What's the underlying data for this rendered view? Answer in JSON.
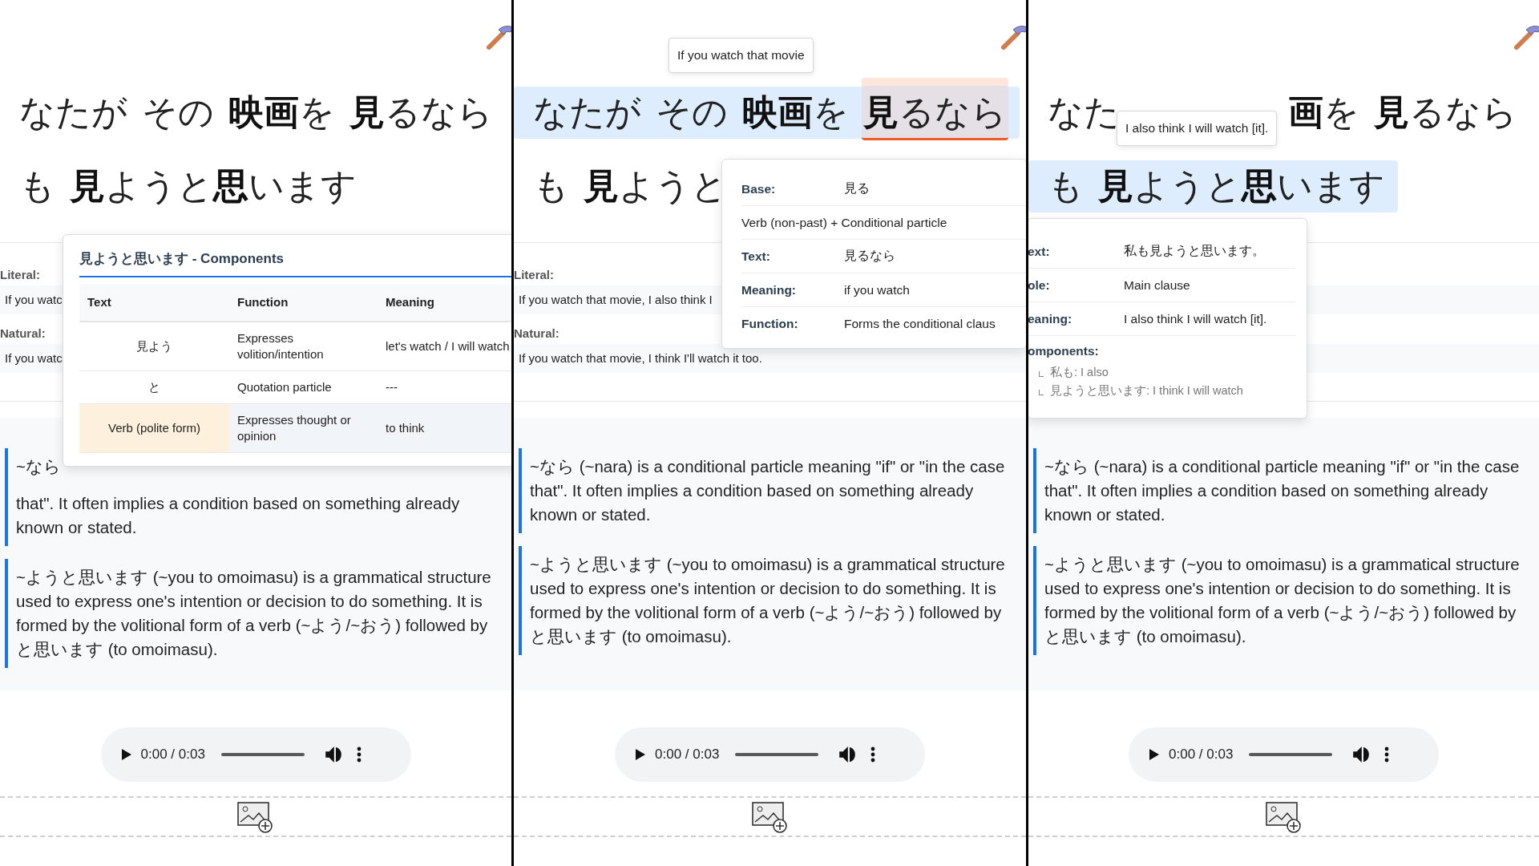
{
  "panels": [
    {
      "sentence": [
        {
          "highlighted": false,
          "covered": false,
          "words": [
            {
              "text": "なたが",
              "selected": false
            },
            {
              "text": "その",
              "selected": false
            },
            {
              "text": "**映画**を",
              "selected": false
            },
            {
              "text": "**見**るなら",
              "selected": false
            }
          ]
        },
        {
          "highlighted": false,
          "covered": false,
          "words": [
            {
              "text": "も",
              "selected": false
            },
            {
              "text": "**見**ようと**思**います",
              "selected": false
            }
          ]
        }
      ],
      "literal": {
        "label": "Literal:",
        "value": "If you watc"
      },
      "natural": {
        "label": "Natural:",
        "value": "If you watc"
      },
      "notes": [
        {
          "parts": [
            "~なら",
            "that\". It often implies a condition based on something already known or stated."
          ]
        },
        {
          "parts": [
            "~ようと思います (~you to omoimasu) is a grammatical structure used to express one's intention or decision to do something. It is formed by the volitional form of a verb (~よう/~おう) followed by と思います (to omoimasu)."
          ]
        }
      ],
      "audio": {
        "time": "0:00 / 0:03",
        "level": 0
      },
      "popup": {
        "kind": "components",
        "title": "見ようと思います - Components",
        "columns": [
          "Text",
          "Function",
          "Meaning"
        ],
        "rows": [
          {
            "cells": [
              "見よう",
              "Expresses volition/intention",
              "let's watch / I will watch"
            ],
            "selected": false
          },
          {
            "cells": [
              "と",
              "Quotation particle",
              "---"
            ],
            "selected": false
          },
          {
            "cells": [
              "Verb (polite form)",
              "Expresses thought or opinion",
              "to think"
            ],
            "selected": true
          }
        ]
      }
    },
    {
      "sentence": [
        {
          "highlighted": true,
          "covered": false,
          "words": [
            {
              "text": "なたが",
              "selected": false
            },
            {
              "text": "その",
              "selected": false
            },
            {
              "text": "**映画**を",
              "selected": false
            },
            {
              "text": "**見**るなら",
              "selected": true
            }
          ]
        },
        {
          "highlighted": false,
          "covered": false,
          "words": [
            {
              "text": "も",
              "selected": false
            },
            {
              "text": "**見**ようと",
              "selected": false
            }
          ]
        }
      ],
      "literal": {
        "label": "Literal:",
        "value": "If you watch that movie, I also think I"
      },
      "natural": {
        "label": "Natural:",
        "value": "If you watch that movie, I think I'll watch it too."
      },
      "notes": [
        {
          "parts": [
            "~なら (~nara) is a conditional particle meaning \"if\" or \"in the case that\". It often implies a condition based on something already known or stated."
          ]
        },
        {
          "parts": [
            "~ようと思います (~you to omoimasu) is a grammatical structure used to express one's intention or decision to do something. It is formed by the volitional form of a verb (~よう/~おう) followed by と思います (to omoimasu)."
          ]
        }
      ],
      "audio": {
        "time": "0:00 / 0:03",
        "level": 0
      },
      "tooltip": {
        "text": "If you watch that movie"
      },
      "popup": {
        "kind": "details",
        "rows": [
          {
            "kind": "pair",
            "label": "Base:",
            "value": "見る"
          },
          {
            "kind": "wide",
            "text": "Verb (non-past) + Conditional particle"
          },
          {
            "kind": "pair",
            "label": "Text:",
            "value": "見るなら"
          },
          {
            "kind": "pair",
            "label": "Meaning:",
            "value": "if you watch"
          },
          {
            "kind": "pair",
            "label": "Function:",
            "value": "Forms the conditional claus"
          }
        ]
      }
    },
    {
      "sentence": [
        {
          "highlighted": false,
          "covered": true,
          "words": [
            {
              "text": "なた",
              "selected": false
            },
            {
              "text": "**画**を",
              "selected": false
            },
            {
              "text": "**見**るなら",
              "selected": false
            }
          ]
        },
        {
          "highlighted": true,
          "covered": false,
          "words": [
            {
              "text": "も",
              "selected": false
            },
            {
              "text": "**見**ようと**思**います",
              "selected": false
            }
          ]
        }
      ],
      "notes": [
        {
          "parts": [
            "~なら (~nara) is a conditional particle meaning \"if\" or \"in the case that\". It often implies a condition based on something already known or stated."
          ]
        },
        {
          "parts": [
            "~ようと思います (~you to omoimasu) is a grammatical structure used to express one's intention or decision to do something. It is formed by the volitional form of a verb (~よう/~おう) followed by と思います (to omoimasu)."
          ]
        }
      ],
      "audio": {
        "time": "0:00 / 0:03",
        "level": 0
      },
      "tooltip": {
        "text": "I also think I will watch [it]."
      },
      "popup": {
        "kind": "details",
        "rows": [
          {
            "kind": "pair",
            "label": "ext:",
            "value": "私も見ようと思います。"
          },
          {
            "kind": "pair",
            "label": "ole:",
            "value": "Main clause"
          },
          {
            "kind": "pair",
            "label": "eaning:",
            "value": "I also think I will watch [it]."
          },
          {
            "kind": "list",
            "label": "omponents:",
            "items": [
              "私も: I also",
              "見ようと思います: I think I will watch"
            ]
          }
        ]
      }
    }
  ]
}
